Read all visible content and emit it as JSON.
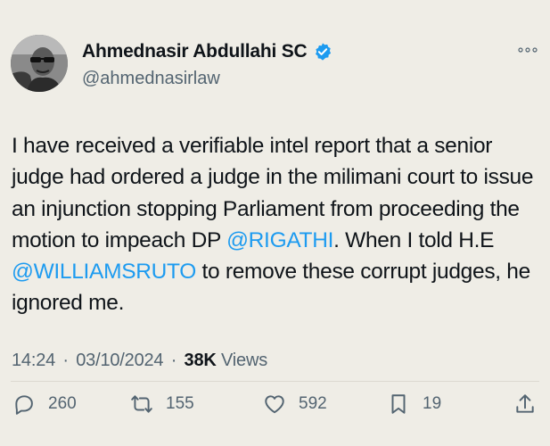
{
  "author": {
    "name": "Ahmednasir Abdullahi SC",
    "handle": "@ahmednasirlaw"
  },
  "tweet": {
    "part1": "I have received a verifiable intel report that a senior judge had ordered a judge in the milimani court to issue an injunction stopping Parliament from proceeding the motion to impeach DP ",
    "mention1": "@RIGATHI",
    "part2": ". When I told H.E ",
    "mention2": "@WILLIAMSRUTO",
    "part3": " to remove these corrupt judges, he ignored me."
  },
  "meta": {
    "time": "14:24",
    "date": "03/10/2024",
    "separator": "·",
    "views_count": "38K",
    "views_label": "Views"
  },
  "actions": {
    "replies": "260",
    "reposts": "155",
    "likes": "592",
    "bookmarks": "19"
  },
  "colors": {
    "background": "#efede6",
    "accent": "#1d9bf0",
    "text": "#0f1419",
    "secondary": "#536471"
  },
  "icons": {
    "verified": "verified-badge-icon",
    "more": "more-dots-icon",
    "reply": "reply-bubble-icon",
    "repost": "repost-icon",
    "like": "heart-icon",
    "bookmark": "bookmark-icon",
    "share": "share-icon"
  }
}
